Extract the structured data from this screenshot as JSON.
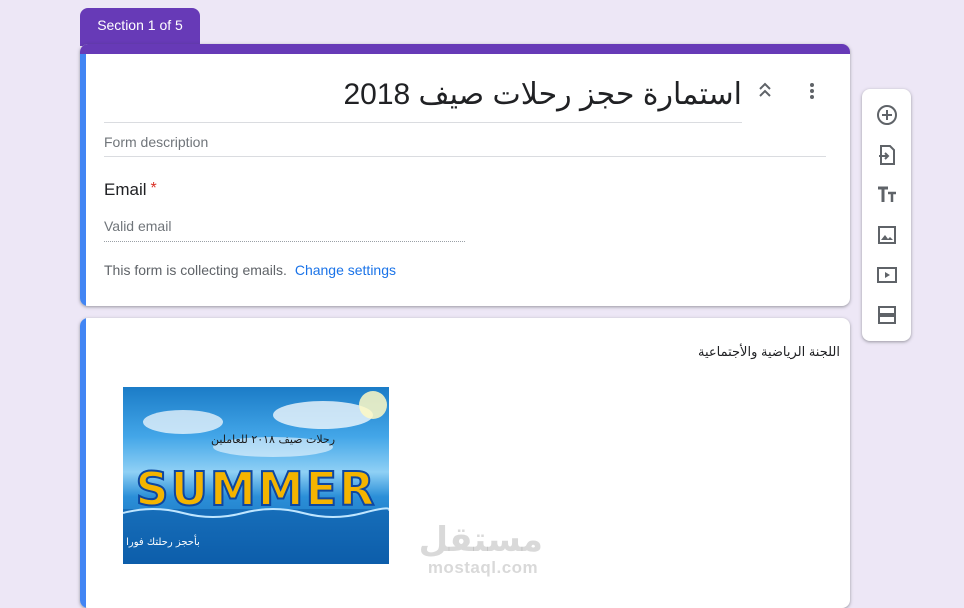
{
  "section_tab": {
    "label": "Section 1 of 5"
  },
  "header_card": {
    "title": "استمارة حجز رحلات صيف 2018",
    "description_placeholder": "Form description",
    "question": {
      "label": "Email",
      "required_marker": "*",
      "placeholder": "Valid email"
    },
    "collecting_note": "This form is collecting emails.",
    "change_settings_link": "Change settings"
  },
  "section_card": {
    "text": "اللجنة الرياضية والأجتماعية",
    "image": {
      "caption_top": "رحلات صيف ٢٠١٨ للعاملين",
      "word": "SUMMER",
      "caption_bottom": "بأحجز رحلتك فورا"
    }
  },
  "toolbar": {
    "icons": [
      "add-question-icon",
      "import-questions-icon",
      "add-title-icon",
      "add-image-icon",
      "add-video-icon",
      "add-section-icon"
    ]
  },
  "watermark": {
    "arabic": "مستقل",
    "latin": "mostaql.com"
  },
  "colors": {
    "accent": "#673ab7",
    "active_bar": "#4285f4",
    "background": "#ede7f6",
    "link": "#1a73e8",
    "required": "#d93025"
  }
}
